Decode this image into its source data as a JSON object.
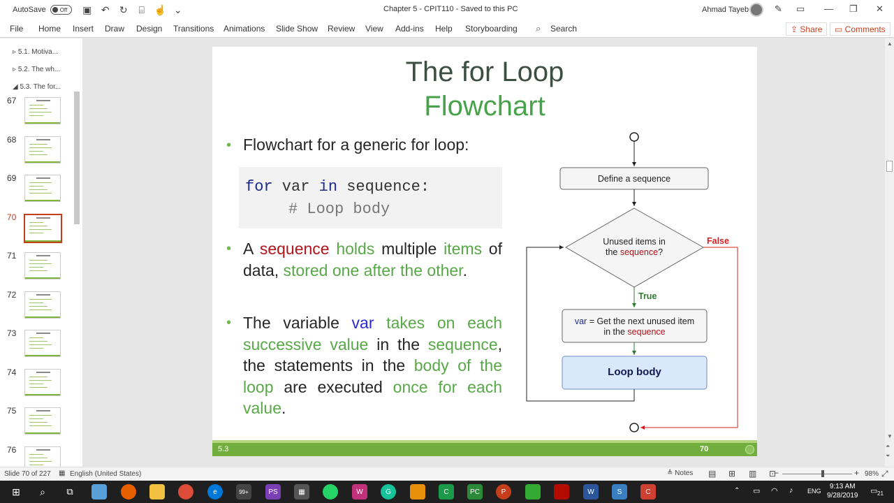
{
  "titlebar": {
    "autosave_label": "AutoSave",
    "autosave_state": "Off",
    "document_title": "Chapter 5 - CPIT110  -  Saved to this PC",
    "user_name": "Ahmad Tayeb"
  },
  "ribbon": {
    "tabs": [
      "File",
      "Home",
      "Insert",
      "Draw",
      "Design",
      "Transitions",
      "Animations",
      "Slide Show",
      "Review",
      "View",
      "Add-ins",
      "Help",
      "Storyboarding"
    ],
    "search_label": "Search",
    "share_label": "Share",
    "comments_label": "Comments"
  },
  "thumbnails": {
    "sections": [
      "5.1. Motiva...",
      "5.2. The wh...",
      "5.3. The for..."
    ],
    "slide_numbers": [
      "67",
      "68",
      "69",
      "70",
      "71",
      "72",
      "73",
      "74",
      "75",
      "76"
    ],
    "active": "70"
  },
  "slide": {
    "title_line1": "The for Loop",
    "title_line2": "Flowchart",
    "bullet1": "Flowchart for a generic for loop:",
    "code": {
      "kw_for": "for",
      "var": " var ",
      "kw_in": "in",
      "rest": " sequence:",
      "comment": "# Loop body"
    },
    "bullet2": {
      "a": "A ",
      "sequence": "sequence",
      "sp": " ",
      "holds": "holds",
      "multiple": " multiple ",
      "items": "items",
      "of_data": " of data, ",
      "stored": "stored one after the other",
      "period": "."
    },
    "bullet3": {
      "the_variable": "The variable ",
      "var": "var",
      "takes": " takes on each successive value",
      "in_the": " in the ",
      "sequence": "sequence",
      "statements": ", the statements in the ",
      "body": "body of the loop",
      "executed": " are executed ",
      "once": "once for each value",
      "period": "."
    },
    "flowchart": {
      "define": "Define a sequence",
      "unused_line1": "Unused items in",
      "unused_line2_pre": "the ",
      "unused_line2_seq": "sequence",
      "unused_line2_post": "?",
      "true_label": "True",
      "false_label": "False",
      "get_var": "var",
      "get_line1_rest": " = Get the next unused item",
      "get_line2_pre": "in the ",
      "get_line2_seq": "sequence",
      "loop_body": "Loop body"
    },
    "footer_section": "5.3",
    "footer_number": "70"
  },
  "statusbar": {
    "slide_info": "Slide 70 of 227",
    "language": "English (United States)",
    "notes_label": "Notes",
    "zoom": "98%"
  },
  "taskbar": {
    "lang": "ENG",
    "time": "9:13 AM",
    "date": "9/28/2019",
    "badge": "99+",
    "notif_count": "21"
  },
  "colors": {
    "accent": "#c43e1c",
    "green": "#58a848",
    "footer_green": "#72ae3e",
    "red_keyword": "#b3131b",
    "blue_keyword": "#2b2bd0"
  }
}
